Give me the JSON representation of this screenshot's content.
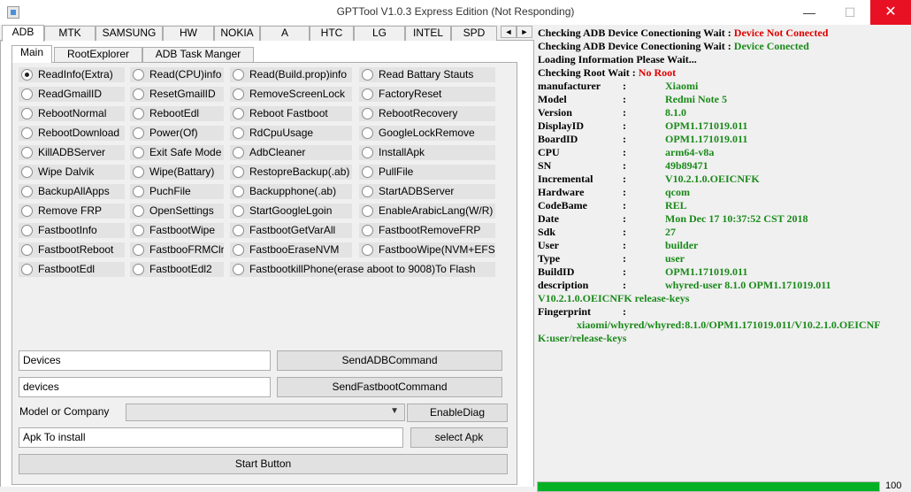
{
  "window": {
    "title": "GPTTool V1.0.3 Express Edition (Not Responding)",
    "min": "—",
    "max": "☐",
    "close": "✕"
  },
  "top_tabs": [
    "ADB",
    "MTK",
    "SAMSUNG",
    "HW",
    "NOKIA",
    "A",
    "HTC",
    "LG",
    "INTEL",
    "SPD"
  ],
  "tab_scroll": {
    "left": "◄",
    "right": "►"
  },
  "sub_tabs": [
    "Main",
    "RootExplorer",
    "ADB Task Manger"
  ],
  "radios": [
    [
      "ReadInfo(Extra)",
      "Read(CPU)info",
      "Read(Build.prop)info",
      "Read Battary Stauts"
    ],
    [
      "ReadGmailID",
      "ResetGmailID",
      "RemoveScreenLock",
      "FactoryReset"
    ],
    [
      "RebootNormal",
      "RebootEdl",
      "Reboot Fastboot",
      "RebootRecovery"
    ],
    [
      "RebootDownload",
      "Power(Of)",
      "RdCpuUsage",
      "GoogleLockRemove"
    ],
    [
      "KillADBServer",
      "Exit Safe Mode",
      "AdbCleaner",
      "InstallApk"
    ],
    [
      "Wipe Dalvik",
      "Wipe(Battary)",
      "RestopreBackup(.ab)",
      "PullFile"
    ],
    [
      "BackupAllApps",
      "PuchFile",
      "Backupphone(.ab)",
      "StartADBServer"
    ],
    [
      "Remove FRP",
      "OpenSettings",
      "StartGoogleLgoin",
      "EnableArabicLang(W/R)"
    ],
    [
      "FastbootInfo",
      "FastbootWipe",
      "FastbootGetVarAll",
      "FastbootRemoveFRP"
    ],
    [
      "FastbootReboot",
      "FastbooFRMClr",
      "FastbooEraseNVM",
      "FastbooWipe(NVM+EFS)"
    ],
    [
      "FastbootEdl",
      "FastbootEdl2",
      "FastbootkillPhone(erase aboot to 9008)To Flash"
    ]
  ],
  "controls": {
    "devices_adb": "Devices",
    "send_adb": "SendADBCommand",
    "devices_fastboot": "devices",
    "send_fastboot": "SendFastbootCommand",
    "model_label": "Model or Company",
    "model_value": "",
    "enable_diag": "EnableDiag",
    "apk_input": "Apk To install",
    "select_apk": "select Apk",
    "start": "Start Button"
  },
  "log": {
    "status_lines": [
      {
        "label": "Checking ADB Device Conectioning Wait : ",
        "value": "Device Not Conected",
        "color": "red"
      },
      {
        "label": "Checking ADB Device Conectioning Wait : ",
        "value": "Device Conected",
        "color": "green"
      },
      {
        "label": "Loading Information Please Wait...",
        "value": "",
        "color": "green"
      },
      {
        "label": "Checking Root Wait : ",
        "value": "No Root",
        "color": "red"
      }
    ],
    "separator": ":",
    "info": [
      {
        "key": "manufacturer",
        "value": "Xiaomi"
      },
      {
        "key": "Model",
        "value": "Redmi Note 5"
      },
      {
        "key": "Version",
        "value": "8.1.0"
      },
      {
        "key": "DisplayID",
        "value": "OPM1.171019.011"
      },
      {
        "key": "BoardID",
        "value": "OPM1.171019.011"
      },
      {
        "key": "CPU",
        "value": "arm64-v8a"
      },
      {
        "key": "SN",
        "value": "49b89471"
      },
      {
        "key": "Incremental",
        "value": "V10.2.1.0.OEICNFK"
      },
      {
        "key": "Hardware",
        "value": "qcom"
      },
      {
        "key": "CodeBame",
        "value": "REL"
      },
      {
        "key": "Date",
        "value": "Mon Dec 17 10:37:52 CST 2018"
      },
      {
        "key": "Sdk",
        "value": "27"
      },
      {
        "key": "User",
        "value": "builder"
      },
      {
        "key": "Type",
        "value": "user"
      },
      {
        "key": " BuildID",
        "value": "OPM1.171019.011"
      },
      {
        "key": "description",
        "value": "whyred-user 8.1.0 OPM1.171019.011"
      }
    ],
    "description_cont": "V10.2.1.0.OEICNFK release-keys",
    "fingerprint_label": "Fingerprint",
    "fingerprint_value_1": "xiaomi/whyred/whyred:8.1.0/OPM1.171019.011/V10.2.1.0.OEICNF",
    "fingerprint_value_2": "K:user/release-keys"
  },
  "progress": {
    "value": 100,
    "label": "100"
  },
  "colors": {
    "red": "#e00000",
    "green": "#1a8a1a",
    "progress": "#06b025",
    "close": "#e81123"
  }
}
